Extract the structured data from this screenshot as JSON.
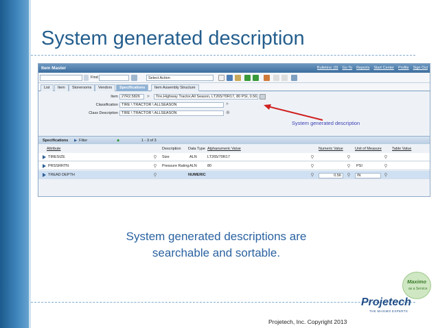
{
  "slide": {
    "title": "System generated description",
    "body_line1": "System generated descriptions are",
    "body_line2": "searchable and sortable.",
    "copyright": "Projetech, Inc. Copyright 2013"
  },
  "screenshot": {
    "app_title": "Item Master",
    "header_links": [
      "Bulletins: (0)",
      "Go To",
      "Reports",
      "Start Center",
      "Profile",
      "Sign Out"
    ],
    "toolbar": {
      "find_label": "Find",
      "select_action": "Select Action"
    },
    "tabs": [
      "List",
      "Item",
      "Storerooms",
      "Vendors",
      "Specifications",
      "Item Assembly Structure"
    ],
    "active_tab": "Specifications",
    "fields": {
      "item_label": "Item",
      "item_value": "27R2.5826",
      "description_value": "Tire,Highway Tractor,All Season, LT265/70R17, 80 PSI, 0.56 I",
      "classification_label": "Classification",
      "classification_value": "TIRE \\ TRACTOR \\ ALLSEASON",
      "class_desc_label": "Class Description",
      "class_desc_value": "TIRE \\ TRACTOR \\ ALLSEASON"
    },
    "callout": "System generated description",
    "specs": {
      "section_label": "Specifications",
      "filter_label": "Filter",
      "pager": "1 - 3 of 3",
      "columns": [
        "Attribute",
        "Description",
        "Data Type",
        "Alphanumeric Value",
        "Numeric Value",
        "Unit of Measure",
        "Table Value"
      ],
      "rows": [
        {
          "attribute": "TIRESIZE",
          "description": "Size",
          "data_type": "ALN",
          "alnvalue": "LT265/70R17",
          "numvalue": "",
          "uom": ""
        },
        {
          "attribute": "PRSSRRTN",
          "description": "Pressure Rating",
          "data_type": "ALN",
          "alnvalue": "80",
          "numvalue": "",
          "uom": "PSI"
        },
        {
          "attribute": "TREAD DEPTH",
          "description": "",
          "data_type": "NUMERIC",
          "alnvalue": "",
          "numvalue": "0.56",
          "uom": "IN"
        }
      ]
    }
  },
  "logo": {
    "badge_line1": "Maximo",
    "badge_line2": "as a Service",
    "brand": "Projetech",
    "tagline": "THE MAXIMO EXPERTS"
  },
  "colors": {
    "accent": "#245e8d",
    "callout": "#3b3fb2",
    "arrow": "#d02020"
  }
}
